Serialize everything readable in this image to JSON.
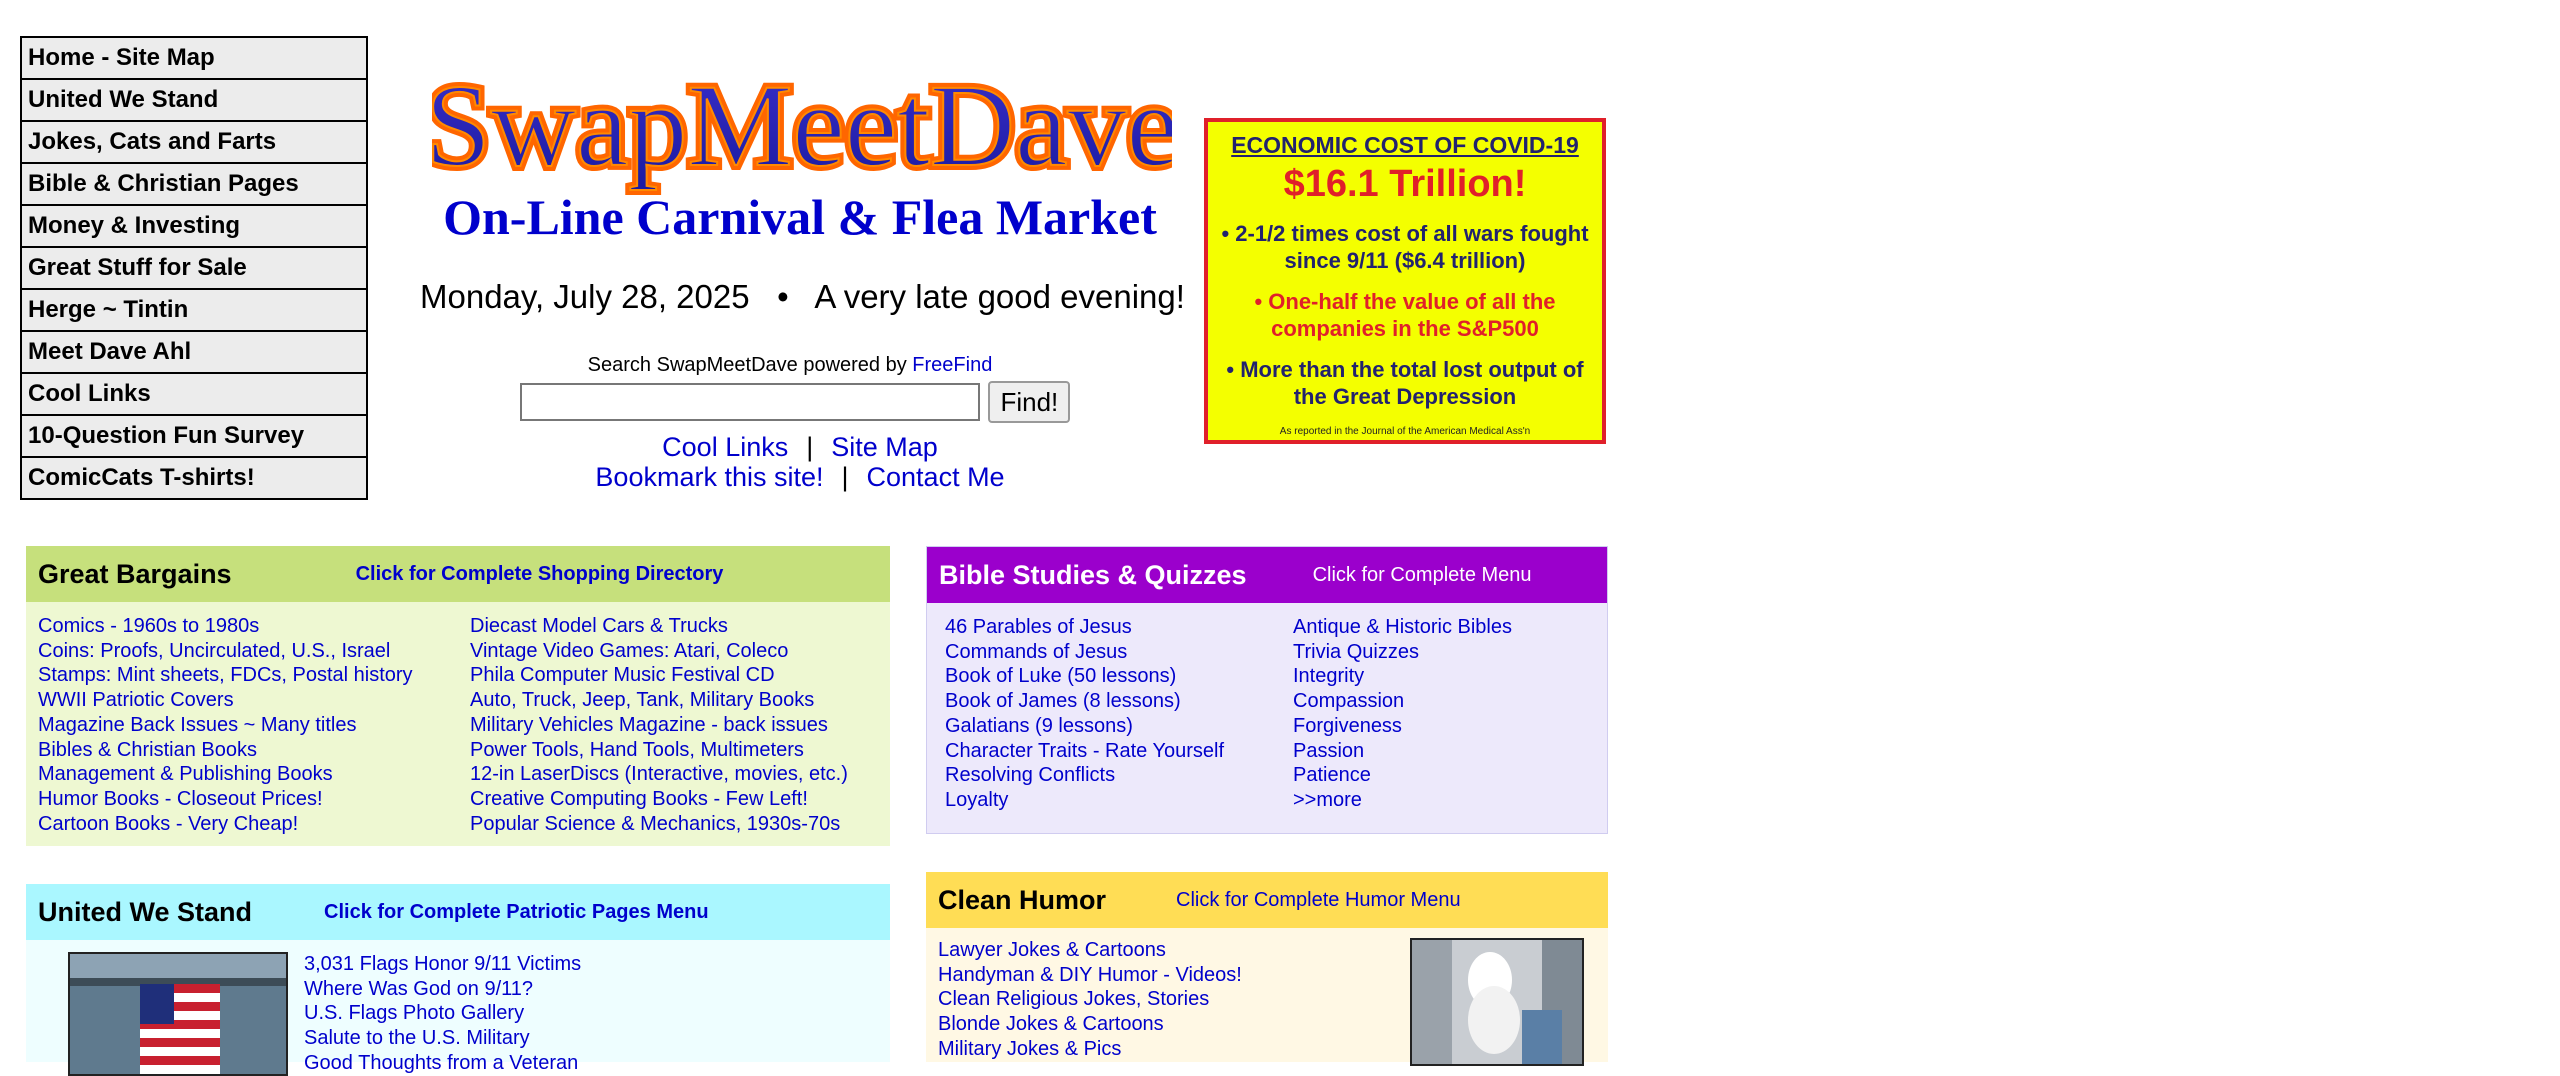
{
  "nav": [
    "Home - Site Map",
    "United We Stand",
    "Jokes, Cats and Farts",
    "Bible & Christian Pages",
    "Money & Investing",
    "Great Stuff for Sale",
    "Herge ~ Tintin",
    "Meet Dave Ahl",
    "Cool Links",
    "10-Question Fun Survey",
    "ComicCats T-shirts!"
  ],
  "header": {
    "logo_text": "SwapMeetDave",
    "tagline": "On-Line Carnival & Flea Market",
    "dateline": "Monday, July 28, 2025   •   A very late good evening!"
  },
  "search": {
    "caption": "Search SwapMeetDave powered by ",
    "powered_link": "FreeFind",
    "input_value": "",
    "button": "Find!"
  },
  "quick_links": {
    "cool_links": "Cool Links",
    "site_map": "Site Map",
    "bookmark": "Bookmark this site!",
    "contact": "Contact Me",
    "separator": "|"
  },
  "covid_ad": {
    "title": "ECONOMIC COST OF COVID-19",
    "amount": "$16.1 Trillion!",
    "point1": "• 2-1/2 times cost of  all wars fought since 9/11 ($6.4 trillion)",
    "point2": "• One-half the value of all the companies in the S&P500",
    "point3": "• More than the total lost output of the Great Depression",
    "note": "As reported in the Journal of the American Medical Ass'n",
    "colors": {
      "background": "#f4ff00",
      "border": "#e0202a",
      "text": "#22226e"
    }
  },
  "bargains": {
    "title": "Great Bargains",
    "menu": "Click for Complete Shopping Directory",
    "col1": [
      "Comics - 1960s to 1980s",
      "Coins: Proofs, Uncirculated, U.S., Israel",
      "Stamps: Mint sheets, FDCs, Postal history",
      "WWII Patriotic Covers",
      "Magazine Back Issues ~ Many titles",
      "Bibles & Christian Books",
      "Management & Publishing Books",
      "Humor Books - Closeout Prices!",
      "Cartoon Books - Very Cheap!"
    ],
    "col2": [
      "Diecast Model Cars & Trucks",
      "Vintage Video Games: Atari, Coleco",
      "Phila Computer Music Festival CD",
      "Auto, Truck, Jeep, Tank, Military Books",
      "Military Vehicles Magazine - back issues",
      "Power Tools, Hand Tools, Multimeters",
      "12-in LaserDiscs (Interactive, movies, etc.)",
      "Creative Computing Books - Few Left!",
      "Popular Science & Mechanics, 1930s-70s"
    ]
  },
  "bible": {
    "title": "Bible Studies & Quizzes",
    "menu": "Click for Complete Menu",
    "col1": [
      "46 Parables of Jesus",
      "Commands of Jesus",
      "Book of Luke (50 lessons)",
      "Book of James (8 lessons)",
      "Galatians (9 lessons)",
      "Character Traits - Rate Yourself",
      "Resolving Conflicts",
      "Loyalty"
    ],
    "col2": [
      "Antique & Historic Bibles",
      "Trivia Quizzes",
      "Integrity",
      "Compassion",
      "Forgiveness",
      "Passion",
      "Patience",
      ">>more"
    ]
  },
  "patriotic": {
    "title": "United We Stand",
    "menu": "Click for Complete Patriotic Pages Menu",
    "links": [
      "3,031 Flags Honor 9/11 Victims",
      "Where Was God on 9/11?",
      "U.S. Flags Photo Gallery",
      "Salute to the U.S. Military",
      "Good Thoughts from a Veteran"
    ]
  },
  "humor": {
    "title": "Clean Humor",
    "menu": "Click for Complete Humor Menu",
    "links": [
      "Lawyer Jokes & Cartoons",
      "Handyman & DIY Humor - Videos!",
      "Clean Religious Jokes, Stories",
      "Blonde Jokes & Cartoons",
      "Military Jokes & Pics"
    ]
  }
}
